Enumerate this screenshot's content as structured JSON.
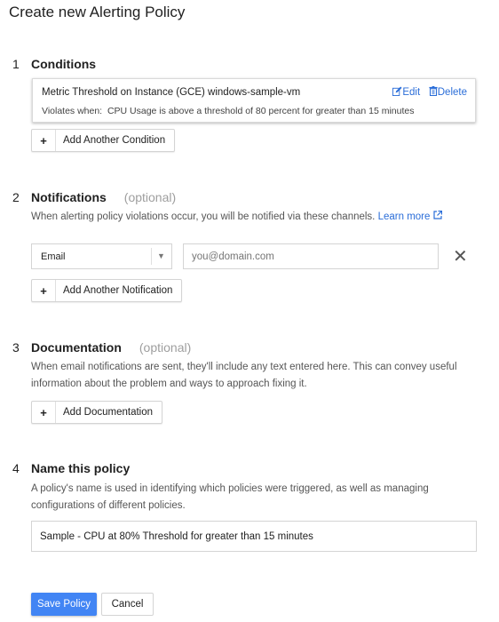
{
  "page": {
    "title": "Create new Alerting Policy"
  },
  "conditions": {
    "number": "1",
    "title": "Conditions",
    "card": {
      "title": "Metric Threshold on Instance (GCE) windows-sample-vm",
      "violates_label": "Violates when:",
      "violates_text": "CPU Usage is above a threshold of 80 percent for greater than 15 minutes",
      "edit_label": "Edit",
      "delete_label": "Delete"
    },
    "add_button": "Add Another Condition"
  },
  "notifications": {
    "number": "2",
    "title": "Notifications",
    "optional": "(optional)",
    "description": "When alerting policy violations occur, you will be notified via these channels.",
    "learn_more": "Learn more",
    "channel_type": "Email",
    "address_placeholder": "you@domain.com",
    "add_button": "Add Another Notification"
  },
  "documentation": {
    "number": "3",
    "title": "Documentation",
    "optional": "(optional)",
    "description_line1": "When email notifications are sent, they'll include any text entered here. This can convey useful",
    "description_line2": "information about the problem and ways to approach fixing it.",
    "add_button": "Add Documentation"
  },
  "name_policy": {
    "number": "4",
    "title": "Name this policy",
    "description_line1": "A policy's name is used in identifying which policies were triggered, as well as managing",
    "description_line2": "configurations of different policies.",
    "value": "Sample - CPU at 80% Threshold for greater than 15 minutes"
  },
  "actions": {
    "save": "Save Policy",
    "cancel": "Cancel"
  },
  "colors": {
    "accent": "#4285f4",
    "link": "#2a6dd8",
    "muted": "#9e9e9e"
  },
  "icons": {
    "edit": "edit-icon",
    "delete": "trash-icon",
    "external": "external-link-icon",
    "close": "close-icon",
    "plus": "plus-icon",
    "caret": "caret-down-icon"
  }
}
